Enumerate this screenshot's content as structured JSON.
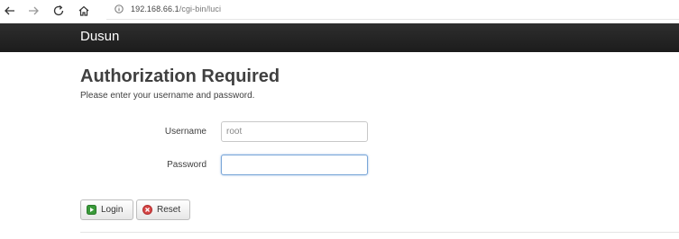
{
  "browser": {
    "url_host": "192.168.66.1",
    "url_path": "/cgi-bin/luci"
  },
  "header": {
    "brand": "Dusun"
  },
  "main": {
    "title": "Authorization Required",
    "subtitle": "Please enter your username and password.",
    "username_label": "Username",
    "username_value": "root",
    "password_label": "Password",
    "password_value": ""
  },
  "buttons": {
    "login_label": "Login",
    "reset_label": "Reset"
  },
  "colors": {
    "header_bg": "#1c1c1c",
    "login_icon": "#3a9a3a",
    "reset_icon": "#d64545",
    "focus_border": "#7aa6d8"
  },
  "icons": [
    "back-arrow-icon",
    "forward-arrow-icon",
    "reload-icon",
    "home-icon",
    "info-icon",
    "login-play-icon",
    "reset-x-icon"
  ]
}
